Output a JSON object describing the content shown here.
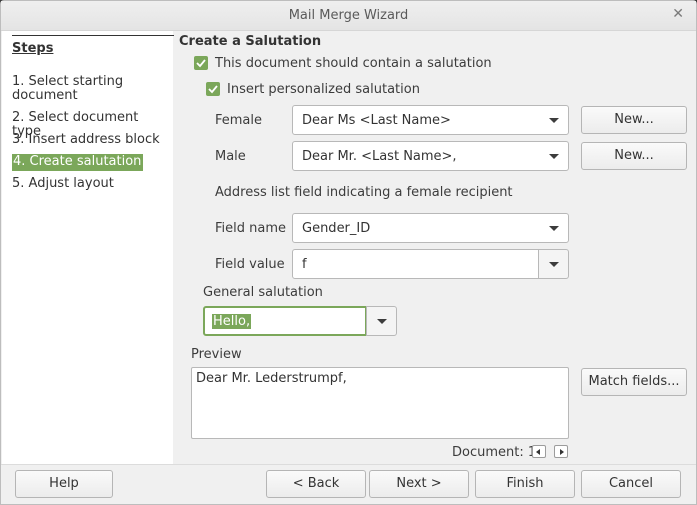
{
  "window": {
    "title": "Mail Merge Wizard"
  },
  "sidebar": {
    "heading": "Steps",
    "steps": [
      {
        "label": "1. Select starting document"
      },
      {
        "label": "2. Select document type"
      },
      {
        "label": "3. Insert address block"
      },
      {
        "label": "4. Create salutation",
        "active": true
      },
      {
        "label": "5. Adjust layout"
      }
    ]
  },
  "main": {
    "title": "Create a Salutation",
    "contain_salutation": {
      "label": "This document should contain a salutation",
      "checked": true
    },
    "personalized": {
      "label": "Insert personalized salutation",
      "checked": true
    },
    "female": {
      "label": "Female",
      "value": "Dear Ms <Last Name>",
      "new_button": "New..."
    },
    "male": {
      "label": "Male",
      "value": "Dear Mr. <Last Name>,",
      "new_button": "New..."
    },
    "address_field_label": "Address list field indicating a female recipient",
    "field_name": {
      "label": "Field name",
      "value": "Gender_ID"
    },
    "field_value": {
      "label": "Field value",
      "value": "f"
    },
    "general": {
      "label": "General salutation",
      "value": "Hello,"
    },
    "preview": {
      "label": "Preview",
      "text": "Dear Mr. Lederstrumpf,",
      "match_button": "Match fields..."
    },
    "document_nav": {
      "label": "Document: 1"
    }
  },
  "footer": {
    "help": "Help",
    "back": "< Back",
    "next": "Next >",
    "finish": "Finish",
    "cancel": "Cancel"
  },
  "colors": {
    "accent": "#7ba75a"
  }
}
